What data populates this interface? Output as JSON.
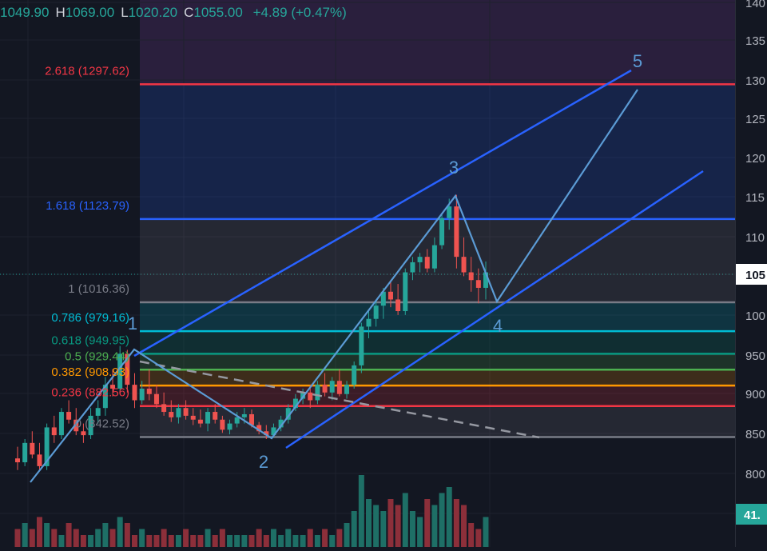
{
  "ohlc": {
    "o_value": "1049.90",
    "h_label": "H",
    "h_value": "1069.00",
    "l_label": "L",
    "l_value": "1020.20",
    "c_label": "C",
    "c_value": "1055.00",
    "change": "+4.89 (+0.47%)"
  },
  "colors": {
    "up": "#26a69a",
    "down": "#ef5350",
    "channel": "#2962ff",
    "wave": "#5b9bd5",
    "background": "#131722"
  },
  "chart_data": {
    "type": "candlestick",
    "y_axis_ticks": [
      "140",
      "135",
      "130",
      "125",
      "120",
      "115",
      "110",
      "105",
      "100",
      "950",
      "900",
      "850",
      "800"
    ],
    "y_axis_current_price": "105",
    "volume_badge": "41.",
    "fib_levels": [
      {
        "label": "2.618 (1297.62)",
        "ratio": 2.618,
        "price": 1297.62,
        "color": "#f23645"
      },
      {
        "label": "1.618 (1123.79)",
        "ratio": 1.618,
        "price": 1123.79,
        "color": "#2962ff"
      },
      {
        "label": "1 (1016.36)",
        "ratio": 1,
        "price": 1016.36,
        "color": "#787b86"
      },
      {
        "label": "0.786 (979.16)",
        "ratio": 0.786,
        "price": 979.16,
        "color": "#00bcd4"
      },
      {
        "label": "0.618 (949.95)",
        "ratio": 0.618,
        "price": 949.95,
        "color": "#089981"
      },
      {
        "label": "0.5 (929.44)",
        "ratio": 0.5,
        "price": 929.44,
        "color": "#4caf50"
      },
      {
        "label": "0.382 (908.93)",
        "ratio": 0.382,
        "price": 908.93,
        "color": "#ff9800"
      },
      {
        "label": "0.236 (882.56)",
        "ratio": 0.236,
        "price": 882.56,
        "color": "#f23645"
      },
      {
        "label": "0 (842.52)",
        "ratio": 0,
        "price": 842.52,
        "color": "#787b86"
      }
    ],
    "wave_labels": [
      "1",
      "2",
      "3",
      "4",
      "5"
    ],
    "candles": [
      [
        815,
        830,
        800,
        810
      ],
      [
        810,
        840,
        805,
        835
      ],
      [
        835,
        850,
        815,
        820
      ],
      [
        820,
        835,
        800,
        805
      ],
      [
        805,
        860,
        800,
        855
      ],
      [
        855,
        870,
        835,
        845
      ],
      [
        845,
        880,
        840,
        875
      ],
      [
        875,
        890,
        860,
        865
      ],
      [
        865,
        880,
        845,
        850
      ],
      [
        850,
        860,
        835,
        845
      ],
      [
        845,
        880,
        840,
        870
      ],
      [
        870,
        890,
        860,
        880
      ],
      [
        880,
        920,
        870,
        910
      ],
      [
        910,
        930,
        895,
        905
      ],
      [
        905,
        960,
        900,
        950
      ],
      [
        950,
        955,
        900,
        910
      ],
      [
        910,
        925,
        880,
        890
      ],
      [
        890,
        915,
        885,
        905
      ],
      [
        905,
        930,
        890,
        898
      ],
      [
        898,
        910,
        880,
        885
      ],
      [
        885,
        900,
        870,
        875
      ],
      [
        875,
        890,
        862,
        868
      ],
      [
        868,
        885,
        860,
        880
      ],
      [
        880,
        890,
        865,
        870
      ],
      [
        870,
        880,
        858,
        865
      ],
      [
        865,
        878,
        855,
        860
      ],
      [
        860,
        880,
        850,
        875
      ],
      [
        875,
        885,
        860,
        865
      ],
      [
        865,
        870,
        848,
        852
      ],
      [
        852,
        865,
        846,
        860
      ],
      [
        860,
        875,
        855,
        868
      ],
      [
        868,
        880,
        860,
        872
      ],
      [
        872,
        878,
        855,
        858
      ],
      [
        858,
        862,
        846,
        850
      ],
      [
        850,
        858,
        840,
        845
      ],
      [
        845,
        860,
        842,
        855
      ],
      [
        855,
        870,
        850,
        865
      ],
      [
        865,
        885,
        860,
        880
      ],
      [
        880,
        898,
        876,
        892
      ],
      [
        892,
        905,
        885,
        900
      ],
      [
        900,
        910,
        880,
        890
      ],
      [
        890,
        915,
        885,
        910
      ],
      [
        910,
        925,
        895,
        900
      ],
      [
        900,
        920,
        890,
        915
      ],
      [
        915,
        930,
        895,
        898
      ],
      [
        898,
        915,
        892,
        910
      ],
      [
        910,
        940,
        905,
        935
      ],
      [
        935,
        990,
        925,
        985
      ],
      [
        985,
        1005,
        970,
        995
      ],
      [
        995,
        1020,
        985,
        1012
      ],
      [
        1012,
        1035,
        995,
        1030
      ],
      [
        1030,
        1045,
        1010,
        1020
      ],
      [
        1020,
        1040,
        1000,
        1005
      ],
      [
        1005,
        1060,
        1000,
        1055
      ],
      [
        1055,
        1075,
        1045,
        1068
      ],
      [
        1068,
        1080,
        1055,
        1075
      ],
      [
        1075,
        1085,
        1055,
        1060
      ],
      [
        1060,
        1100,
        1055,
        1090
      ],
      [
        1090,
        1130,
        1085,
        1125
      ],
      [
        1125,
        1150,
        1110,
        1140
      ],
      [
        1140,
        1155,
        1060,
        1075
      ],
      [
        1075,
        1100,
        1050,
        1055
      ],
      [
        1055,
        1075,
        1030,
        1045
      ],
      [
        1045,
        1060,
        1015,
        1035
      ],
      [
        1035,
        1069,
        1020,
        1055
      ]
    ],
    "volume": [
      3,
      4,
      3,
      5,
      4,
      3,
      2,
      4,
      3,
      2,
      2,
      3,
      4,
      3,
      5,
      4,
      2,
      3,
      2,
      2,
      3,
      2,
      2,
      3,
      2,
      2,
      3,
      2,
      3,
      2,
      2,
      2,
      2,
      3,
      2,
      3,
      2,
      3,
      2,
      2,
      3,
      2,
      3,
      2,
      3,
      4,
      6,
      12,
      8,
      7,
      6,
      8,
      7,
      9,
      6,
      5,
      8,
      7,
      9,
      10,
      8,
      7,
      4,
      3,
      5
    ]
  }
}
